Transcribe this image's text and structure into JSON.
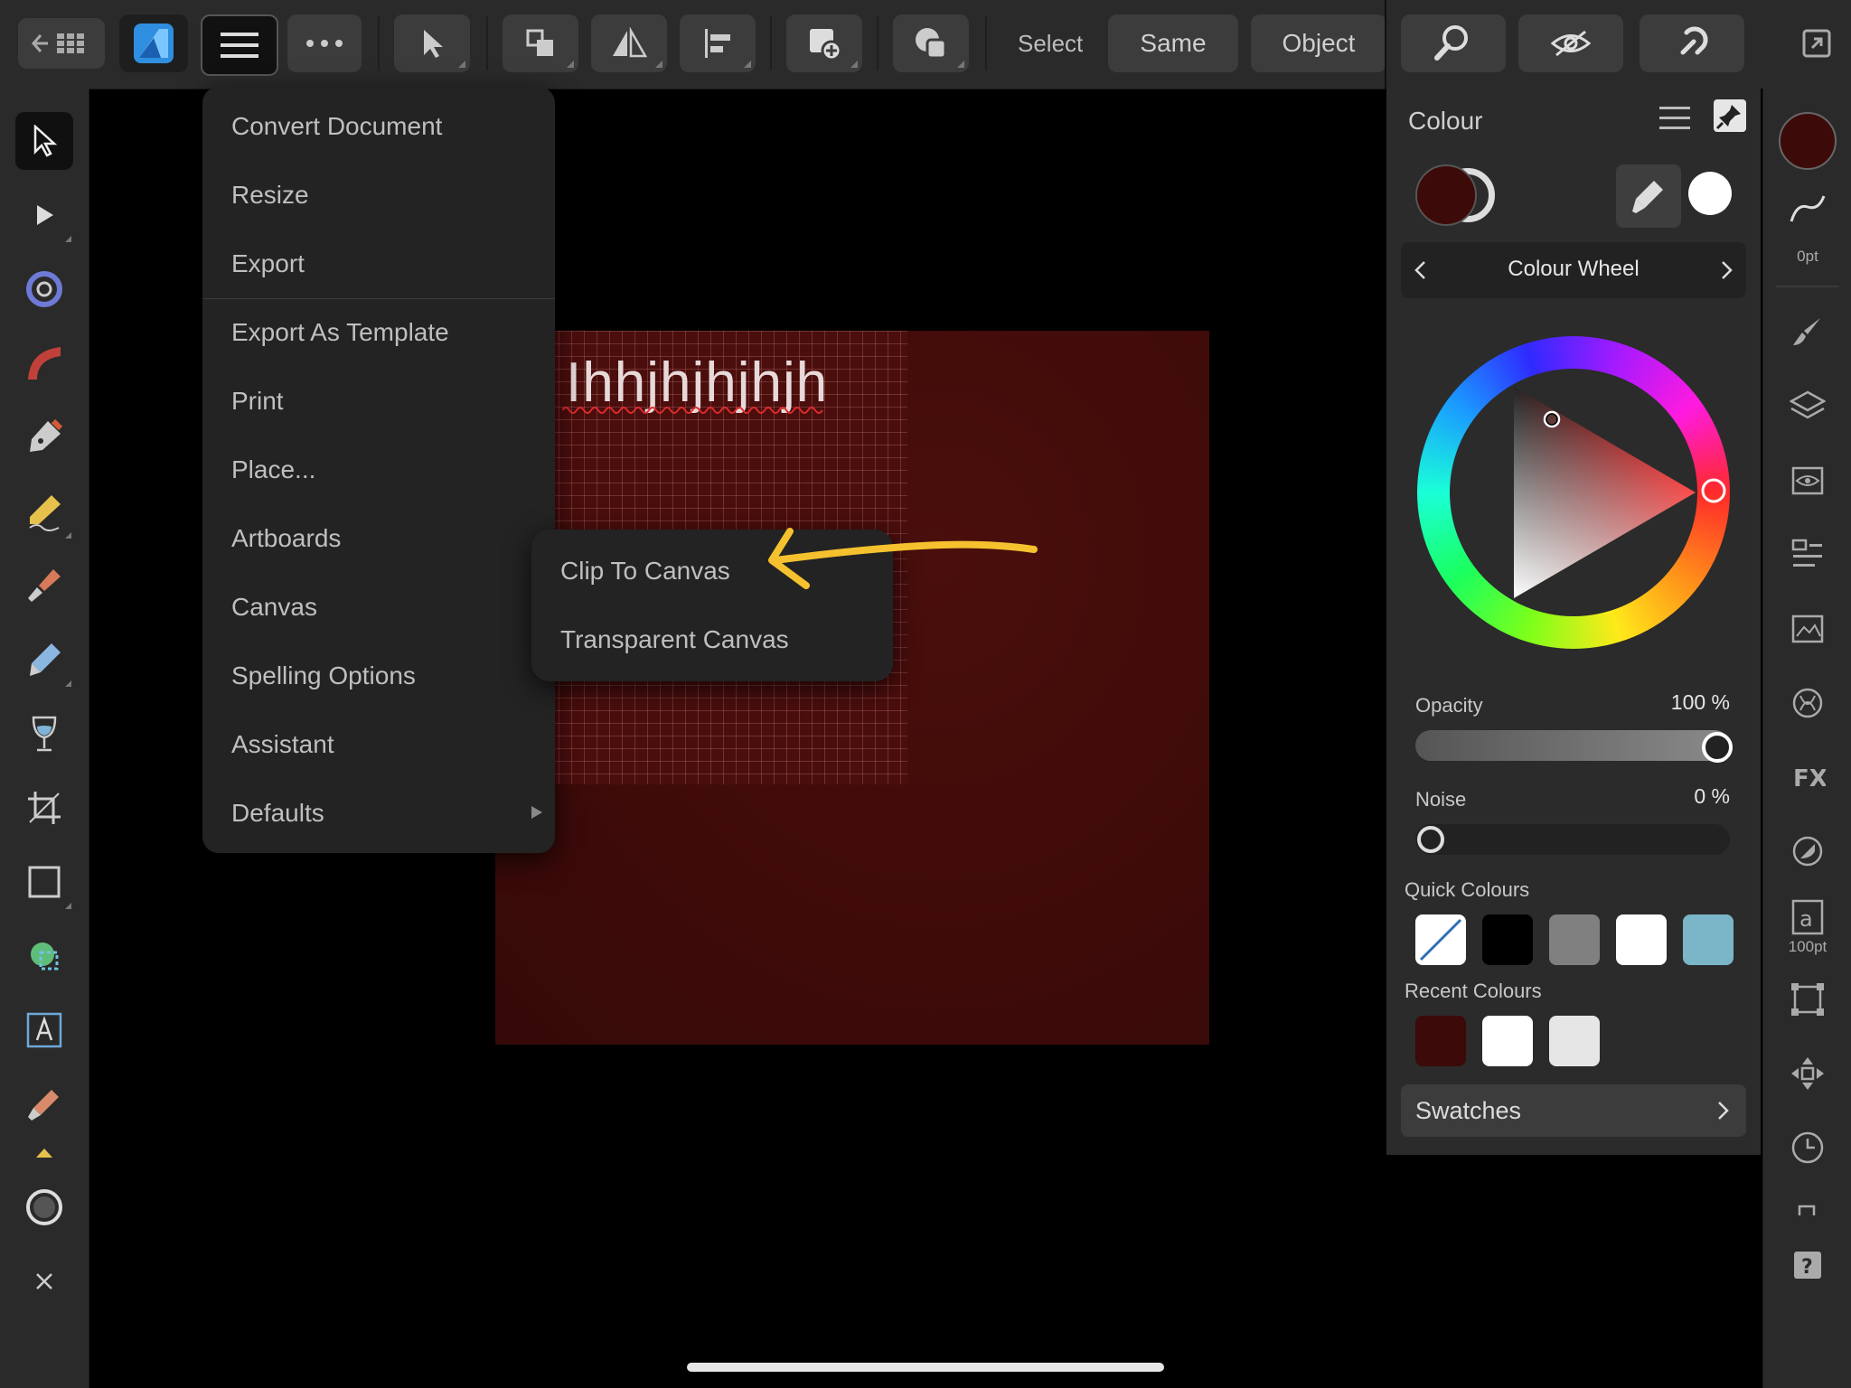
{
  "toolbar": {
    "select_label": "Select",
    "same_label": "Same",
    "object_label": "Object"
  },
  "canvas": {
    "text": "Ihhjhjhjhjh",
    "background_color": "#400c0a"
  },
  "document_menu": {
    "items": [
      "Convert Document",
      "Resize",
      "Export",
      "Export As Template",
      "Print",
      "Place...",
      "Artboards",
      "Canvas",
      "Spelling Options",
      "Assistant",
      "Defaults"
    ]
  },
  "canvas_submenu": {
    "items": [
      "Clip To Canvas",
      "Transparent Canvas"
    ]
  },
  "colour_panel": {
    "title": "Colour",
    "mode": "Colour Wheel",
    "opacity_label": "Opacity",
    "opacity_value": "100 %",
    "opacity_level": 1.0,
    "noise_label": "Noise",
    "noise_value": "0 %",
    "noise_level": 0.0,
    "fill_color": "#3c0a08",
    "quick_colours_label": "Quick Colours",
    "quick_colours": [
      "none",
      "#000000",
      "#808080",
      "#ffffff",
      "#7ab6c8"
    ],
    "recent_colours_label": "Recent Colours",
    "recent_colours": [
      "#3c0a08",
      "#ffffff",
      "#e6e6e6"
    ],
    "swatches_label": "Swatches"
  },
  "right_strip": {
    "stroke_caption": "0pt",
    "text_caption": "100pt"
  },
  "annotation_color": "#f5c12e"
}
